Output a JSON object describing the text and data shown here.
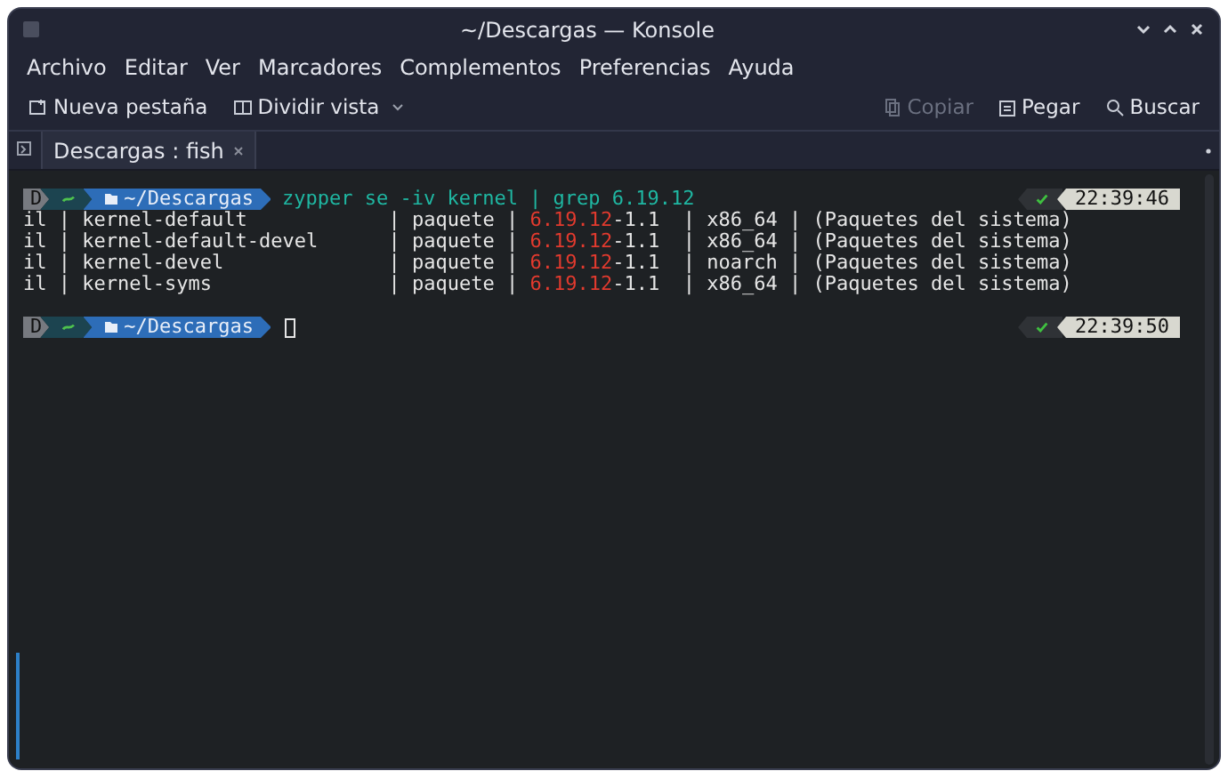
{
  "window": {
    "title": "~/Descargas — Konsole"
  },
  "menu": [
    "Archivo",
    "Editar",
    "Ver",
    "Marcadores",
    "Complementos",
    "Preferencias",
    "Ayuda"
  ],
  "toolbar": {
    "left": [
      {
        "label": "Nueva pestaña",
        "kind": "new-tab",
        "disabled": false
      },
      {
        "label": "Dividir vista",
        "kind": "split",
        "disabled": false
      }
    ],
    "right": [
      {
        "label": "Copiar",
        "kind": "copy",
        "disabled": true
      },
      {
        "label": "Pegar",
        "kind": "paste",
        "disabled": false
      },
      {
        "label": "Buscar",
        "kind": "search",
        "disabled": false
      }
    ]
  },
  "tabs": [
    {
      "label": "Descargas : fish",
      "selected": true
    }
  ],
  "terminal": {
    "blocks": [
      {
        "prompt": {
          "host": "D",
          "path": "~/Descargas"
        },
        "command": "zypper se -iv kernel | grep 6.19.12",
        "time": "22:39:46",
        "output": [
          {
            "before": "il | kernel-default            | paquete | ",
            "match": "6.19.12",
            "after": "-1.1  | x86_64 | (Paquetes del sistema)"
          },
          {
            "before": "il | kernel-default-devel      | paquete | ",
            "match": "6.19.12",
            "after": "-1.1  | x86_64 | (Paquetes del sistema)"
          },
          {
            "before": "il | kernel-devel              | paquete | ",
            "match": "6.19.12",
            "after": "-1.1  | noarch | (Paquetes del sistema)"
          },
          {
            "before": "il | kernel-syms               | paquete | ",
            "match": "6.19.12",
            "after": "-1.1  | x86_64 | (Paquetes del sistema)"
          }
        ]
      },
      {
        "prompt": {
          "host": "D",
          "path": "~/Descargas"
        },
        "time": "22:39:50"
      }
    ]
  }
}
